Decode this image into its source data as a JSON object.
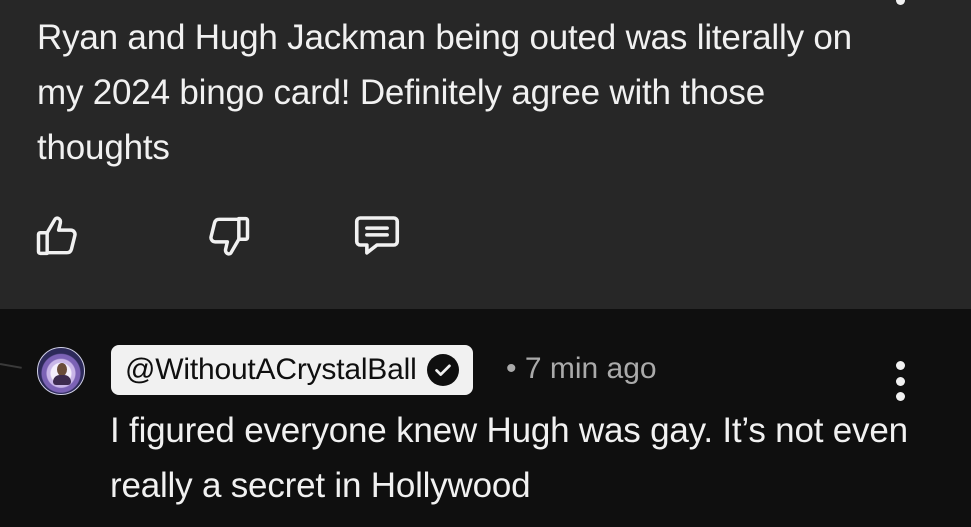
{
  "top_comment": {
    "text": "Ryan and Hugh Jackman being outed was literally on my 2024 bingo card! Definitely agree with those thoughts",
    "actions": {
      "like_icon": "thumbs-up-icon",
      "dislike_icon": "thumbs-down-icon",
      "reply_icon": "comment-icon"
    }
  },
  "reply_comment": {
    "author_handle": "@WithoutACrystalBall",
    "verified_icon": "verified-check-icon",
    "meta": "• 7 min ago",
    "text": "I figured everyone knew Hugh was gay. It’s not even really a secret in Hollywood",
    "menu_icon": "more-vert-icon"
  },
  "colors": {
    "top_background": "#272727",
    "page_background": "#0f0f0f",
    "text_primary": "#f1f1f1",
    "text_secondary": "#aaaaaa",
    "chip_background": "#f1f1f1"
  }
}
